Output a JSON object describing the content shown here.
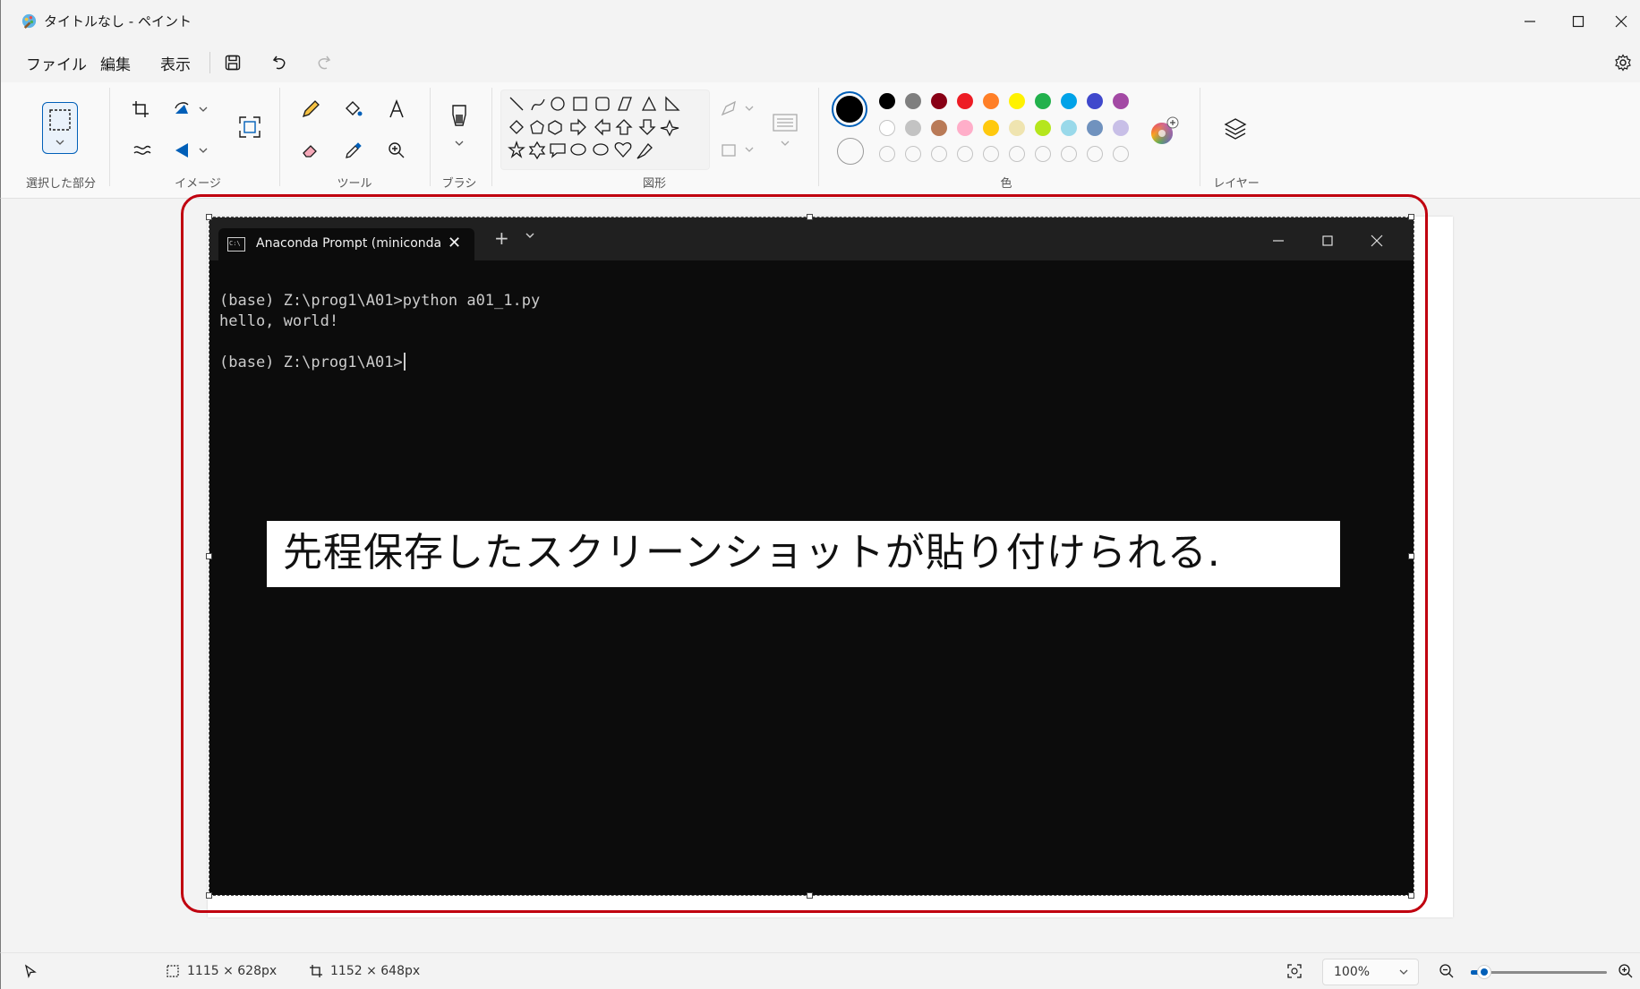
{
  "window": {
    "title": "タイトルなし - ペイント"
  },
  "menu": {
    "file": "ファイル",
    "edit": "編集",
    "view": "表示"
  },
  "ribbon": {
    "groups": {
      "selection": "選択した部分",
      "image": "イメージ",
      "tools": "ツール",
      "brush": "ブラシ",
      "shapes": "図形",
      "colors": "色",
      "layers": "レイヤー"
    },
    "palette_row1": [
      "#000000",
      "#7f7f7f",
      "#880015",
      "#ed1c24",
      "#ff7f27",
      "#fff200",
      "#22b14c",
      "#00a2e8",
      "#3f48cc",
      "#a349a4"
    ],
    "palette_row2": [
      "#ffffff",
      "#c3c3c3",
      "#b97a57",
      "#ffaec9",
      "#ffc90e",
      "#efe4b0",
      "#b5e61d",
      "#99d9ea",
      "#7092be",
      "#c8bfe7"
    ],
    "primary_color": "#000000",
    "secondary_color": "#ffffff"
  },
  "terminal": {
    "tab_label": "Anaconda Prompt (miniconda",
    "lines": [
      "(base) Z:\\prog1\\A01>python a01_1.py",
      "hello, world!",
      "",
      "(base) Z:\\prog1\\A01>"
    ]
  },
  "caption": "先程保存したスクリーンショットが貼り付けられる.",
  "status": {
    "selection_size": "1115 × 628px",
    "canvas_size": "1152 × 648px",
    "zoom": "100%",
    "zoom_fraction": 0.1
  },
  "colors": {
    "annotation_frame": "#c0000f",
    "accent": "#005fb8"
  }
}
